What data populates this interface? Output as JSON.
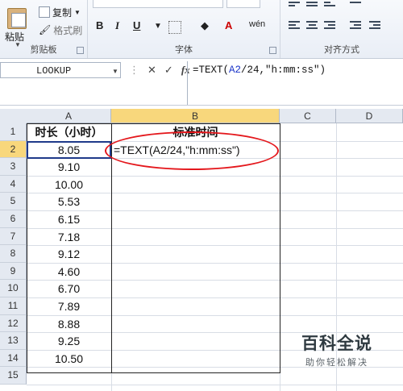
{
  "ribbon": {
    "clipboard": {
      "paste": "粘贴",
      "copy": "复制",
      "format_painter": "格式刷",
      "group_label": "剪贴板"
    },
    "font": {
      "bold": "B",
      "italic": "I",
      "underline": "U",
      "phonetic": "wén",
      "font_color_letter": "A",
      "group_label": "字体"
    },
    "alignment": {
      "group_label": "对齐方式"
    }
  },
  "formula_bar": {
    "name_box": "LOOKUP",
    "cancel_icon": "✕",
    "enter_icon": "✓",
    "fx": "fx",
    "formula_prefix": "=TEXT(",
    "formula_ref": "A2",
    "formula_suffix": "/24,\"h:mm:ss\")"
  },
  "columns": [
    "A",
    "B",
    "C",
    "D"
  ],
  "rows": [
    "1",
    "2",
    "3",
    "4",
    "5",
    "6",
    "7",
    "8",
    "9",
    "10",
    "11",
    "12",
    "13",
    "14",
    "15"
  ],
  "table": {
    "headers": {
      "a": "时长（小时）",
      "b": "标准时间"
    },
    "durations": [
      "8.05",
      "9.10",
      "10.00",
      "5.53",
      "6.15",
      "7.18",
      "9.12",
      "4.60",
      "6.70",
      "7.89",
      "8.88",
      "9.25",
      "10.50"
    ],
    "editing_cell_text": "=TEXT(A2/24,\"h:mm:ss\")"
  },
  "watermark": {
    "title": "百科全说",
    "subtitle": "助你轻松解决"
  }
}
